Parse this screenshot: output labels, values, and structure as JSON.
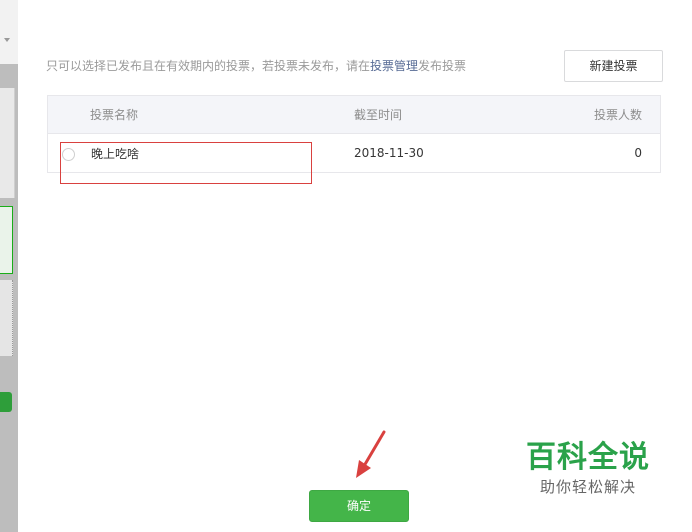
{
  "notice": {
    "text_before": "只可以选择已发布且在有效期内的投票，若投票未发布，请在",
    "link": "投票管理",
    "text_after": "发布投票"
  },
  "new_vote_button": "新建投票",
  "table": {
    "columns": [
      "投票名称",
      "截至时间",
      "投票人数"
    ],
    "rows": [
      {
        "name": "晚上吃啥",
        "deadline": "2018-11-30",
        "count": "0",
        "selected": false
      }
    ]
  },
  "confirm_button": "确定",
  "watermark": {
    "title": "百科全说",
    "subtitle": "助你轻松解决"
  },
  "colors": {
    "primary_green": "#44b549",
    "link": "#576b95",
    "annotation_red": "#d9413f"
  }
}
